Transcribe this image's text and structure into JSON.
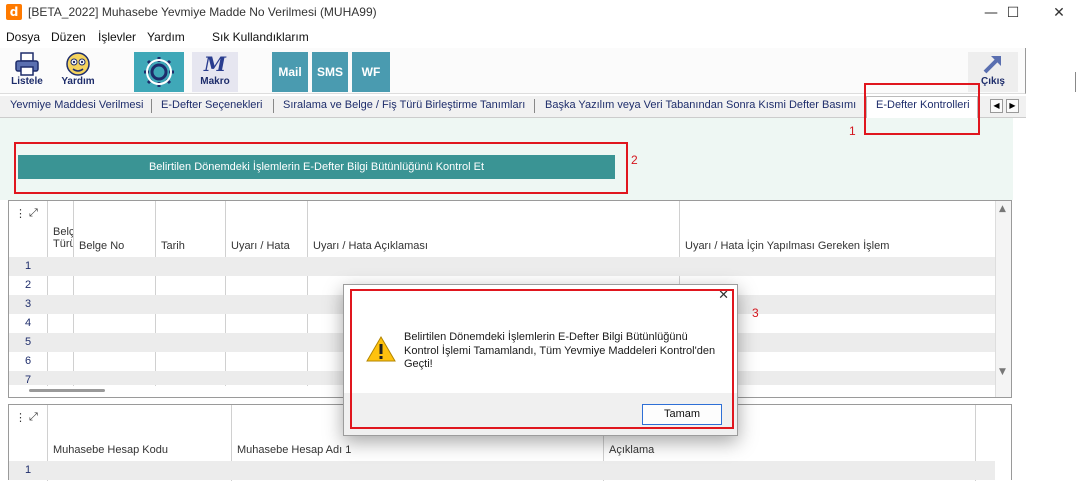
{
  "window": {
    "title": "[BETA_2022] Muhasebe Yevmiye Madde No Verilmesi (MUHA99)",
    "app_icon_letter": "d",
    "minimize": "—",
    "maximize": "☐",
    "close": "✕"
  },
  "menu": [
    "Dosya",
    "Düzen",
    "İşlevler",
    "Yardım",
    "Sık Kullandıklarım"
  ],
  "toolbar": {
    "listele": "Listele",
    "yardim": "Yardım",
    "makro": "Makro",
    "mail": "Mail",
    "sms": "SMS",
    "wf": "WF",
    "cikis": "Çıkış"
  },
  "tabs": [
    "Yevmiye Maddesi Verilmesi",
    "E-Defter Seçenekleri",
    "Sıralama ve Belge / Fiş Türü Birleştirme Tanımları",
    "Başka Yazılım veya Veri Tabanından Sonra Kısmi Defter Basımı",
    "E-Defter Kontrolleri"
  ],
  "panel": {
    "check_button": "Belirtilen Dönemdeki İşlemlerin E-Defter Bilgi Bütünlüğünü Kontrol Et"
  },
  "grid1": {
    "headers": {
      "belge_turu_line1": "Belç",
      "belge_turu_line2": "Türü",
      "belge_no": "Belge No",
      "tarih": "Tarih",
      "uyari": "Uyarı / Hata",
      "uyari_aciklama": "Uyarı / Hata Açıklaması",
      "gereken_islem": "Uyarı / Hata İçin Yapılması Gereken İşlem"
    },
    "rows": [
      "1",
      "2",
      "3",
      "4",
      "5",
      "6",
      "7"
    ]
  },
  "grid2": {
    "headers": {
      "hesap_kodu": "Muhasebe Hesap Kodu",
      "hesap_adi": "Muhasebe Hesap Adı 1",
      "aciklama": "Açıklama"
    },
    "rows": [
      "1"
    ]
  },
  "annotations": [
    "1",
    "2",
    "3"
  ],
  "dialog": {
    "message": "Belirtilen Dönemdeki İşlemlerin E-Defter Bilgi Bütünlüğünü Kontrol İşlemi Tamamlandı, Tüm Yevmiye Maddeleri Kontrol'den Geçti!",
    "ok": "Tamam",
    "close": "✕"
  },
  "colors": {
    "teal_button": "#3a9494",
    "annotation_red": "#e0161e",
    "toolbar_teal": "#4a9bb0"
  }
}
